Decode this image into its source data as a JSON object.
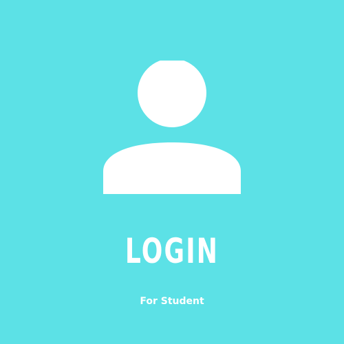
{
  "title": "LOGIN",
  "subtitle": "For Student",
  "icon": "user-icon",
  "colors": {
    "background": "#5ce1e6",
    "foreground": "#ffffff"
  }
}
